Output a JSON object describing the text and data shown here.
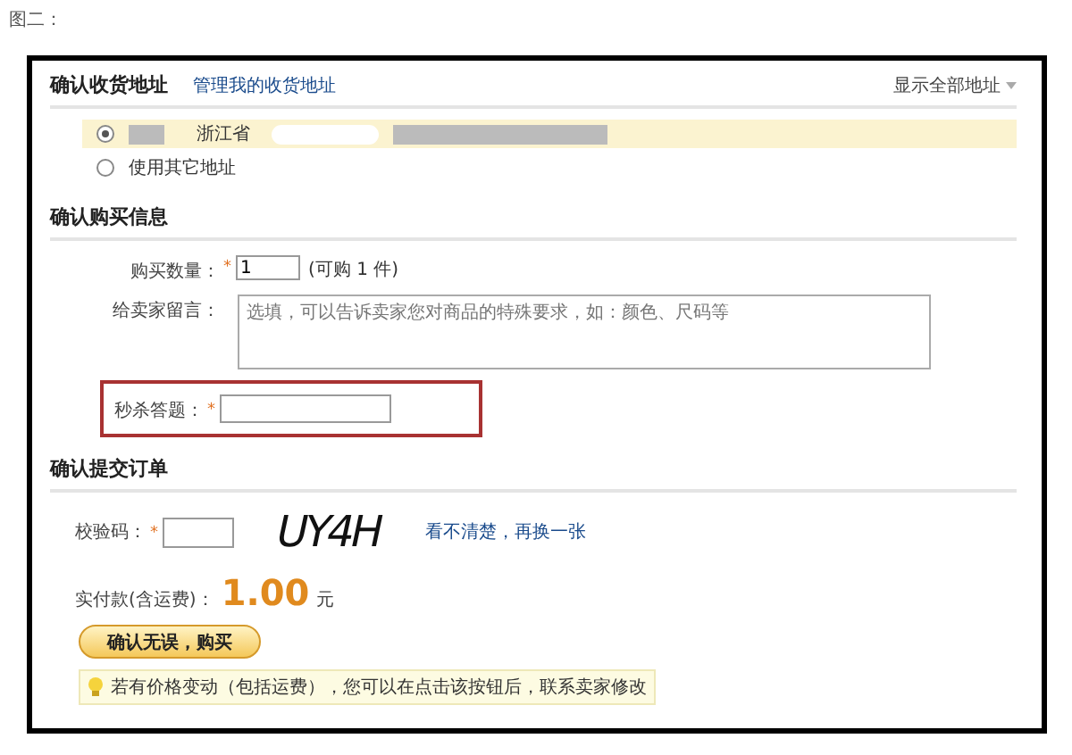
{
  "caption": "图二：",
  "address": {
    "title": "确认收货地址",
    "manage_link": "管理我的收货地址",
    "show_all": "显示全部地址",
    "options": [
      {
        "kind": "address",
        "province": "浙江省",
        "selected": true
      },
      {
        "kind": "other",
        "label": "使用其它地址",
        "selected": false
      }
    ]
  },
  "purchase": {
    "title": "确认购买信息",
    "required_mark": "*",
    "quantity_label": "购买数量：",
    "quantity_value": "1",
    "quantity_note": "(可购 1 件)",
    "message_label": "给卖家留言：",
    "message_placeholder": "选填，可以告诉卖家您对商品的特殊要求，如：颜色、尺码等",
    "answer_label": "秒杀答题："
  },
  "submit": {
    "title": "确认提交订单",
    "code_label": "校验码：",
    "captcha": "UY4H",
    "refresh_link": "看不清楚，再换一张",
    "total_label": "实付款(含运费)：",
    "total_amount": "1.00",
    "currency": "元",
    "button": "确认无误，购买",
    "tip": "若有价格变动（包括运费），您可以在点击该按钮后，联系卖家修改"
  }
}
